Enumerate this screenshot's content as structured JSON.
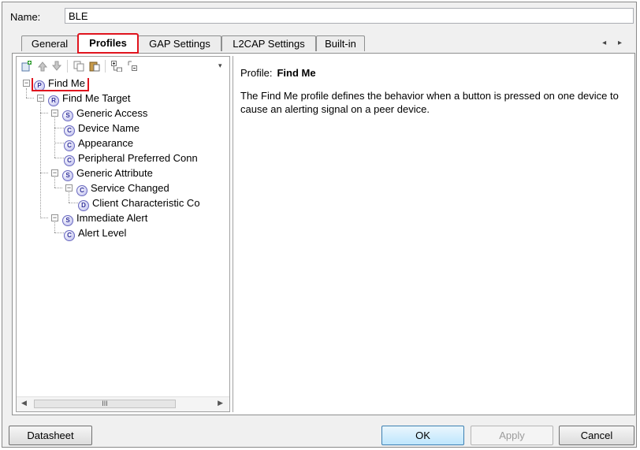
{
  "name": {
    "label": "Name:",
    "value": "BLE"
  },
  "tabs": [
    {
      "label": "General"
    },
    {
      "label": "Profiles",
      "active": true
    },
    {
      "label": "GAP Settings"
    },
    {
      "label": "L2CAP Settings"
    },
    {
      "label": "Built-in"
    }
  ],
  "tab_scroll": "◂ ▸",
  "tree": [
    {
      "label": "Find Me",
      "badge": "P"
    },
    {
      "label": "Find Me Target",
      "badge": "R"
    },
    {
      "label": "Generic Access",
      "badge": "S"
    },
    {
      "label": "Device Name",
      "badge": "C"
    },
    {
      "label": "Appearance",
      "badge": "C"
    },
    {
      "label": "Peripheral Preferred Conn",
      "badge": "C"
    },
    {
      "label": "Generic Attribute",
      "badge": "S"
    },
    {
      "label": "Service Changed",
      "badge": "C"
    },
    {
      "label": "Client Characteristic Co",
      "badge": "D"
    },
    {
      "label": "Immediate Alert",
      "badge": "S"
    },
    {
      "label": "Alert Level",
      "badge": "C"
    }
  ],
  "detail": {
    "profile_label": "Profile:",
    "profile_name": "Find Me",
    "description": "The Find Me profile defines the behavior when a button is pressed on one device to cause an alerting signal on a peer device."
  },
  "buttons": {
    "datasheet": "Datasheet",
    "ok": "OK",
    "apply": "Apply",
    "cancel": "Cancel"
  },
  "scroll_thumb": "III",
  "colors": {
    "highlight": "#e0141e",
    "badge": "#6a6ac0"
  }
}
